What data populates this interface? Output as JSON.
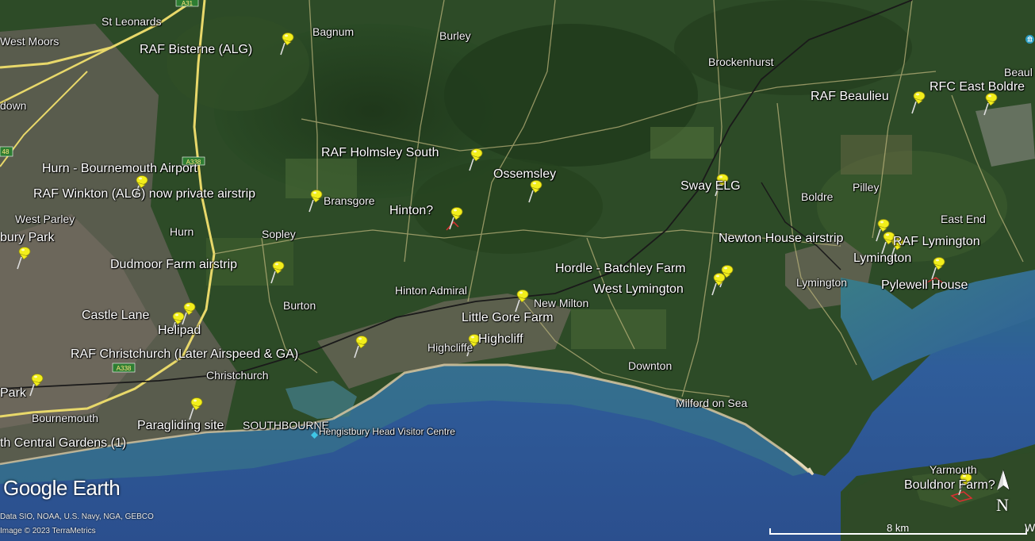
{
  "map": {
    "watermark": "Google Earth",
    "credits": [
      "Data SIO, NOAA, U.S. Navy, NGA, GEBCO",
      "Image © 2023 TerraMetrics"
    ],
    "scale_label": "8 km",
    "compass_label": "N",
    "edge_letter": "W",
    "colors": {
      "land": "#2b4a27",
      "sea": "#2f5f9a",
      "sea_shallow": "#3e7f83",
      "urban": "#6f6a5f",
      "beach": "#d8c7a0",
      "road_major": "#e8d86a",
      "road_minor": "#b9b27a",
      "railway": "#1a1a1a",
      "pin": "#f2ee1b"
    }
  },
  "placemarks": [
    {
      "label": "RAF Bisterne (ALG)",
      "icon": "pushpin-icon"
    },
    {
      "label": "RAF Holmsley South",
      "icon": "pushpin-icon"
    },
    {
      "label": "Ossemsley",
      "icon": "pushpin-icon"
    },
    {
      "label": "Hinton?",
      "icon": "pushpin-icon"
    },
    {
      "label": "Hurn - Bournemouth Airport",
      "icon": "pushpin-icon"
    },
    {
      "label": "RAF Winkton (ALG) now private airstrip",
      "icon": "pushpin-icon"
    },
    {
      "label": "Dudmoor Farm airstrip",
      "icon": "pushpin-icon"
    },
    {
      "label": "Castle Lane",
      "icon": "pushpin-icon"
    },
    {
      "label": "Helipad",
      "icon": "pushpin-icon"
    },
    {
      "label": "RAF Christchurch (Later Airspeed & GA)",
      "icon": "pushpin-icon"
    },
    {
      "label": "Paragliding site",
      "icon": "pushpin-icon"
    },
    {
      "label": "Little Gore Farm",
      "icon": "pushpin-icon"
    },
    {
      "label": "Highcliff",
      "icon": "pushpin-icon"
    },
    {
      "label": "Hordle - Batchley Farm",
      "icon": "pushpin-icon"
    },
    {
      "label": "West Lymington",
      "icon": "pushpin-icon"
    },
    {
      "label": "Sway ELG",
      "icon": "pushpin-icon"
    },
    {
      "label": "Newton House airstrip",
      "icon": "pushpin-icon"
    },
    {
      "label": "RAF Lymington",
      "icon": "pushpin-icon"
    },
    {
      "label": "Lymington",
      "icon": "pushpin-icon"
    },
    {
      "label": "Pylewell House",
      "icon": "pushpin-icon"
    },
    {
      "label": "RAF Beaulieu",
      "icon": "pushpin-icon"
    },
    {
      "label": "RFC East Boldre",
      "icon": "pushpin-icon"
    },
    {
      "label": "Bouldnor Farm?",
      "icon": "pushpin-icon"
    },
    {
      "label": "bury Park",
      "icon": "pushpin-icon"
    },
    {
      "label": "Park",
      "icon": "pushpin-icon"
    },
    {
      "label": "th Central Gardens (1)",
      "icon": "pushpin-icon"
    }
  ],
  "place_names": [
    "St Leonards",
    "West Moors",
    "down",
    "Bagnum",
    "Burley",
    "Brockenhurst",
    "Beaul",
    "Bransgore",
    "Sopley",
    "West Parley",
    "Hurn",
    "Burton",
    "Hinton Admiral",
    "New Milton",
    "Highcliffe",
    "Christchurch",
    "Bournemouth",
    "SOUTHBOURNE",
    "Hengistbury Head Visitor Centre",
    "Boldre",
    "Pilley",
    "East End",
    "Lymington",
    "Downton",
    "Milford on Sea",
    "Yarmouth"
  ],
  "road_shields": [
    "A31",
    "A338",
    "A338",
    "48"
  ]
}
